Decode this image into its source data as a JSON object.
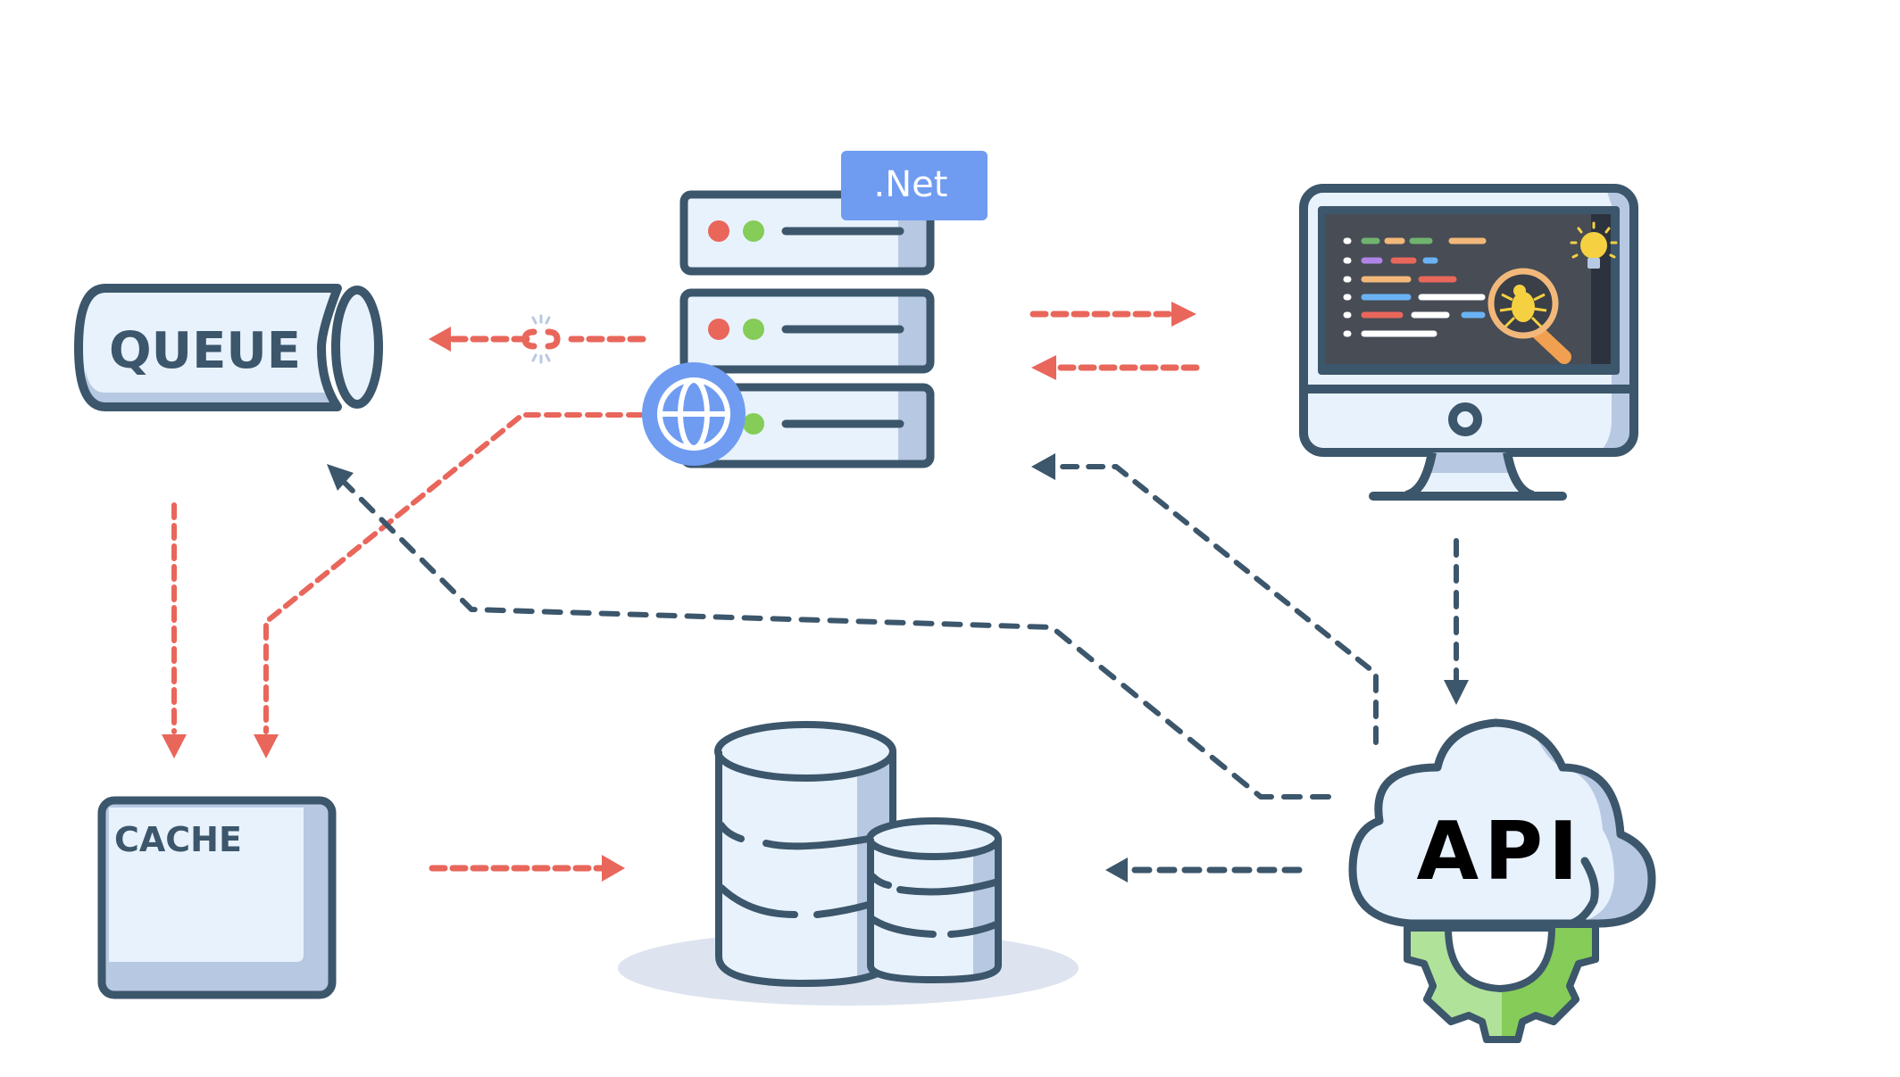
{
  "diagram": {
    "colors": {
      "outline": "#3c566b",
      "fill_light": "#e8f2fc",
      "fill_shadow": "#b7c8e2",
      "accent_red": "#e9665b",
      "accent_blue": "#6f9cf1",
      "accent_green": "#85cc59",
      "screen_dark": "#474c55"
    },
    "nodes": {
      "queue": {
        "label": "QUEUE",
        "icon": "pipe-icon"
      },
      "server": {
        "badge": ".Net",
        "icon": "server-rack-icon",
        "overlay_icon": "globe-icon"
      },
      "monitor": {
        "icon": "monitor-code-debug-icon",
        "overlays": [
          "bug-magnifier-icon",
          "lightbulb-icon"
        ]
      },
      "cache": {
        "label": "CACHE",
        "icon": "cache-box-icon"
      },
      "database": {
        "icon": "database-stack-icon"
      },
      "api": {
        "label": "API",
        "icon": "cloud-gear-icon"
      }
    },
    "edges": [
      {
        "id": "server-to-queue",
        "from": "server",
        "to": "queue",
        "color": "red",
        "style": "dashed",
        "broken": true
      },
      {
        "id": "server-to-monitor",
        "from": "server",
        "to": "monitor",
        "color": "red",
        "style": "dashed"
      },
      {
        "id": "monitor-to-server",
        "from": "monitor",
        "to": "server",
        "color": "red",
        "style": "dashed"
      },
      {
        "id": "globe-to-cache",
        "from": "server",
        "to": "cache",
        "color": "red",
        "style": "dashed"
      },
      {
        "id": "queue-to-cache",
        "from": "queue",
        "to": "cache",
        "color": "red",
        "style": "dashed"
      },
      {
        "id": "cache-to-database",
        "from": "cache",
        "to": "database",
        "color": "red",
        "style": "dashed"
      },
      {
        "id": "monitor-to-api",
        "from": "monitor",
        "to": "api",
        "color": "dark",
        "style": "dashed"
      },
      {
        "id": "api-to-server",
        "from": "api",
        "to": "server",
        "color": "dark",
        "style": "dashed"
      },
      {
        "id": "api-to-queue",
        "from": "api",
        "to": "queue",
        "color": "dark",
        "style": "dashed"
      },
      {
        "id": "api-to-database",
        "from": "api",
        "to": "database",
        "color": "dark",
        "style": "dashed"
      }
    ]
  }
}
